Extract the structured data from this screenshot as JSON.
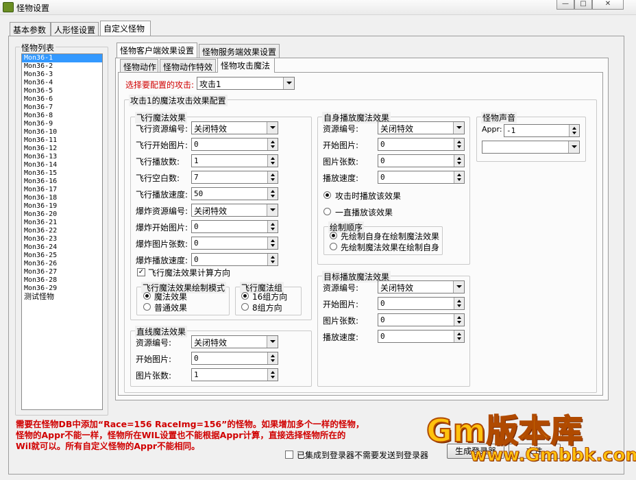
{
  "window": {
    "title": "怪物设置",
    "minimize": "—",
    "maximize": "□",
    "close": "✕"
  },
  "top_tabs": [
    "基本参数",
    "人形怪设置",
    "自定义怪物"
  ],
  "monster_list": {
    "title": "怪物列表",
    "items": [
      "Mon36-1",
      "Mon36-2",
      "Mon36-3",
      "Mon36-4",
      "Mon36-5",
      "Mon36-6",
      "Mon36-7",
      "Mon36-8",
      "Mon36-9",
      "Mon36-10",
      "Mon36-11",
      "Mon36-12",
      "Mon36-13",
      "Mon36-14",
      "Mon36-15",
      "Mon36-16",
      "Mon36-17",
      "Mon36-18",
      "Mon36-19",
      "Mon36-20",
      "Mon36-21",
      "Mon36-22",
      "Mon36-23",
      "Mon36-24",
      "Mon36-25",
      "Mon36-26",
      "Mon36-27",
      "Mon36-28",
      "Mon36-29",
      "测试怪物"
    ],
    "selected_index": 0
  },
  "sub_tabs": [
    "怪物客户端效果设置",
    "怪物服务端效果设置"
  ],
  "inner_tabs": [
    "怪物动作",
    "怪物动作特效",
    "怪物攻击魔法"
  ],
  "attack_select": {
    "label": "选择要配置的攻击:",
    "value": "攻击1"
  },
  "attack_config_title": "攻击1的魔法攻击效果配置",
  "flying": {
    "title": "飞行魔法效果",
    "fields": [
      {
        "label": "飞行资源编号:",
        "value": "关闭特效",
        "kind": "combo"
      },
      {
        "label": "飞行开始图片:",
        "value": "0",
        "kind": "spin"
      },
      {
        "label": "飞行播放数:",
        "value": "1",
        "kind": "spin"
      },
      {
        "label": "飞行空白数:",
        "value": "7",
        "kind": "spin"
      },
      {
        "label": "飞行播放速度:",
        "value": "50",
        "kind": "spin"
      },
      {
        "label": "爆炸资源编号:",
        "value": "关闭特效",
        "kind": "combo"
      },
      {
        "label": "爆炸开始图片:",
        "value": "0",
        "kind": "spin"
      },
      {
        "label": "爆炸图片张数:",
        "value": "0",
        "kind": "spin"
      },
      {
        "label": "爆炸播放速度:",
        "value": "0",
        "kind": "spin"
      }
    ],
    "direction_check": "飞行魔法效果计算方向",
    "draw_mode": {
      "title": "飞行魔法效果绘制模式",
      "options": [
        "魔法效果",
        "普通效果"
      ]
    },
    "magic_group": {
      "title": "飞行魔法组",
      "options": [
        "16组方向",
        "8组方向"
      ]
    }
  },
  "straight": {
    "title": "直线魔法效果",
    "fields": [
      {
        "label": "资源编号:",
        "value": "关闭特效",
        "kind": "combo"
      },
      {
        "label": "开始图片:",
        "value": "0",
        "kind": "spin"
      },
      {
        "label": "图片张数:",
        "value": "1",
        "kind": "spin"
      }
    ]
  },
  "self_play": {
    "title": "自身播放魔法效果",
    "fields": [
      {
        "label": "资源编号:",
        "value": "关闭特效",
        "kind": "combo"
      },
      {
        "label": "开始图片:",
        "value": "0",
        "kind": "spin"
      },
      {
        "label": "图片张数:",
        "value": "0",
        "kind": "spin"
      },
      {
        "label": "播放速度:",
        "value": "0",
        "kind": "spin"
      }
    ],
    "play_options": [
      "攻击时播放该效果",
      "一直播放该效果"
    ],
    "draw_order": {
      "title": "绘制顺序",
      "options": [
        "先绘制自身在绘制魔法效果",
        "先绘制魔法效果在绘制自身"
      ]
    }
  },
  "target_play": {
    "title": "目标播放魔法效果",
    "fields": [
      {
        "label": "资源编号:",
        "value": "关闭特效",
        "kind": "combo"
      },
      {
        "label": "开始图片:",
        "value": "0",
        "kind": "spin"
      },
      {
        "label": "图片张数:",
        "value": "0",
        "kind": "spin"
      },
      {
        "label": "播放速度:",
        "value": "0",
        "kind": "spin"
      }
    ]
  },
  "sound": {
    "title": "怪物声音",
    "appr_label": "Appr:",
    "appr_value": "-1",
    "combo_value": ""
  },
  "note": {
    "lines": [
      "需要在怪物DB中添加“Race=156 RaceImg=156”的怪物。如果增加多个一样的怪物，",
      "怪物的Appr不能一样，怪物所在WIL设置也不能根据Appr计算，直接选择怪物所在的",
      "Wil就可以。所有自定义怪物的Appr不能相同。"
    ],
    "color": "#d00000"
  },
  "login_check": "已集成到登录器不需要发送到登录器",
  "buttons": {
    "generate": "生成登录器",
    "save_file": "文件"
  },
  "watermark": {
    "main": "Gm版本库",
    "url": "www.Gmbbk.com"
  }
}
